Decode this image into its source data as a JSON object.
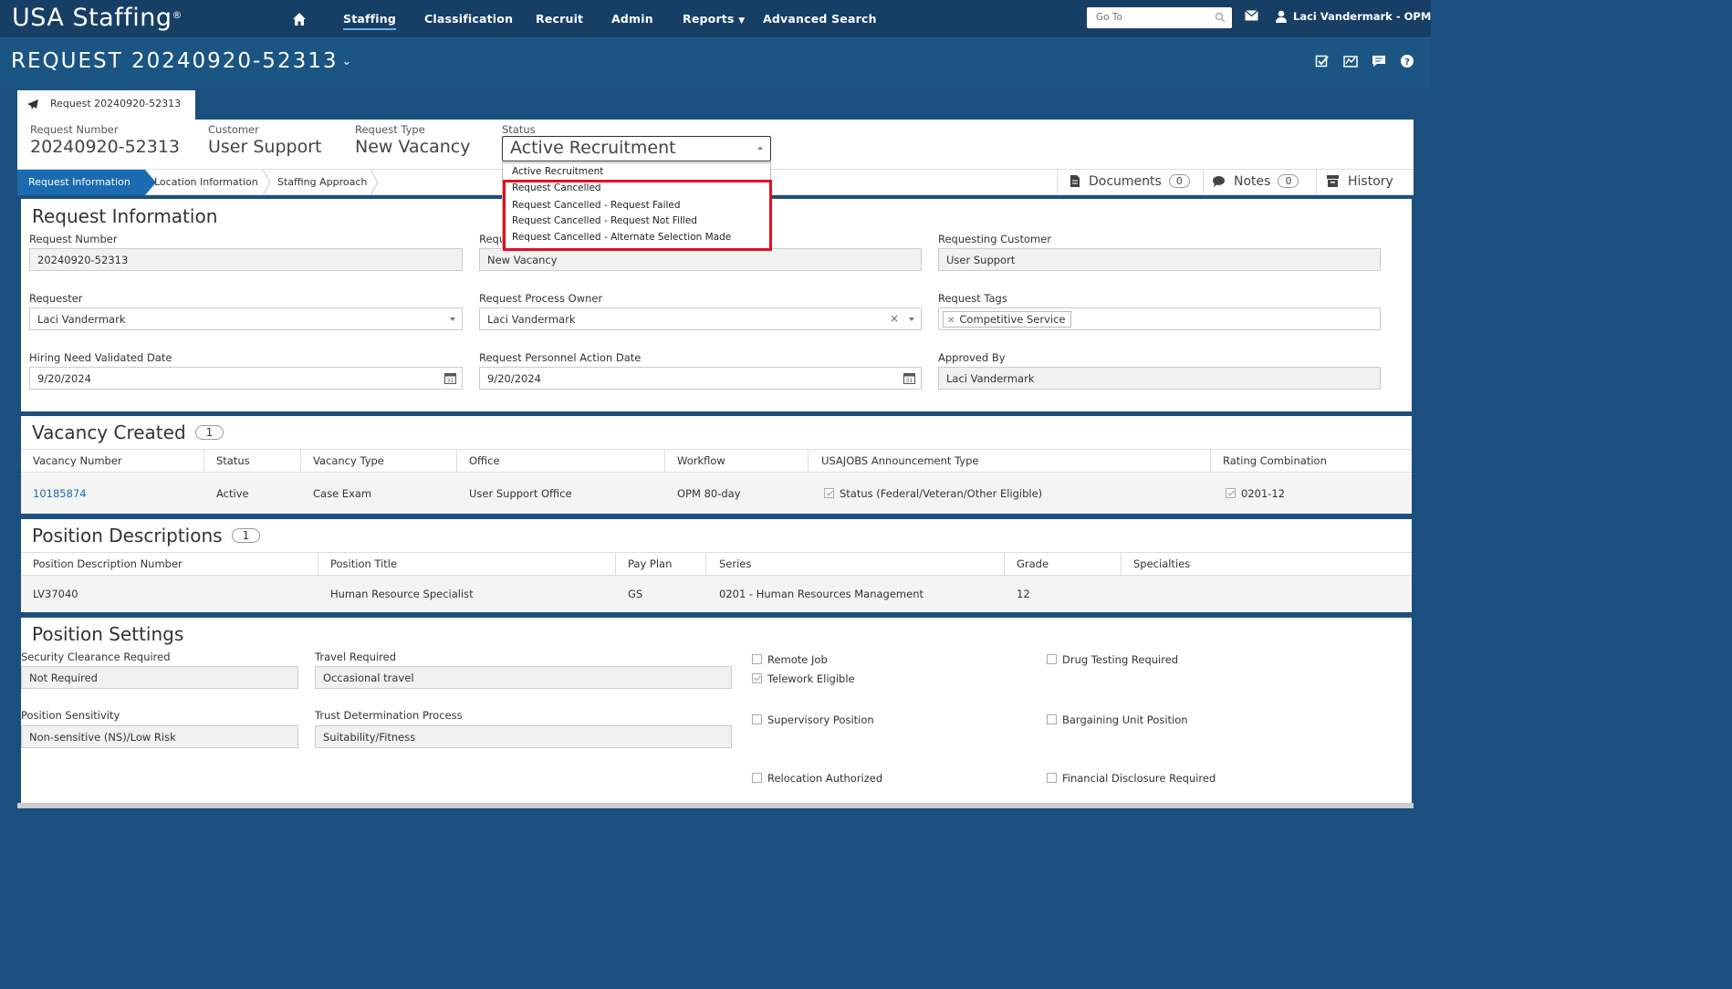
{
  "topbar": {
    "brand": "USA Staffing",
    "brand_mark": "®",
    "nav": [
      "Staffing",
      "Classification",
      "Recruit",
      "Admin",
      "Reports",
      "Advanced Search"
    ],
    "active_nav": "Staffing",
    "goto_placeholder": "Go To",
    "user": "Laci Vandermark - OPM"
  },
  "header": {
    "title": "REQUEST 20240920-52313",
    "tab_label": "Request 20240920-52313"
  },
  "summary": {
    "request_number_label": "Request Number",
    "request_number": "20240920-52313",
    "customer_label": "Customer",
    "customer": "User Support",
    "request_type_label": "Request Type",
    "request_type": "New Vacancy",
    "status_label": "Status",
    "status": "Active Recruitment"
  },
  "status_dropdown": {
    "options": [
      "Active Recruitment",
      "Request Cancelled",
      "Request Cancelled - Request Failed",
      "Request Cancelled - Request Not Filled",
      "Request Cancelled - Alternate Selection Made"
    ],
    "highlight_color": "#e0101e"
  },
  "subnav": {
    "crumbs": [
      "Request Information",
      "Location Information",
      "Staffing Approach"
    ],
    "documents_label": "Documents",
    "documents_count": "0",
    "notes_label": "Notes",
    "notes_count": "0",
    "history_label": "History"
  },
  "request_info": {
    "title": "Request Information",
    "request_number_label": "Request Number",
    "request_number": "20240920-52313",
    "request_type_label_partial": "Requ",
    "request_type": "New Vacancy",
    "requesting_customer_label": "Requesting Customer",
    "requesting_customer": "User Support",
    "requester_label": "Requester",
    "requester": "Laci Vandermark",
    "process_owner_label": "Request Process Owner",
    "process_owner": "Laci Vandermark",
    "tags_label": "Request Tags",
    "tag": "Competitive Service",
    "hiring_date_label": "Hiring Need Validated Date",
    "hiring_date": "9/20/2024",
    "pa_date_label": "Request Personnel Action Date",
    "pa_date": "9/20/2024",
    "approved_by_label": "Approved By",
    "approved_by": "Laci Vandermark"
  },
  "vacancy": {
    "title": "Vacancy Created",
    "count": "1",
    "headers": [
      "Vacancy Number",
      "Status",
      "Vacancy Type",
      "Office",
      "Workflow",
      "USAJOBS Announcement Type",
      "Rating Combination"
    ],
    "row": {
      "number": "10185874",
      "status": "Active",
      "type": "Case Exam",
      "office": "User Support Office",
      "workflow": "OPM 80-day",
      "announcement": "Status (Federal/Veteran/Other Eligible)",
      "rating": "0201-12"
    }
  },
  "positions": {
    "title": "Position Descriptions",
    "count": "1",
    "headers": [
      "Position Description Number",
      "Position Title",
      "Pay Plan",
      "Series",
      "Grade",
      "Specialties"
    ],
    "row": {
      "number": "LV37040",
      "title": "Human Resource Specialist",
      "pay_plan": "GS",
      "series": "0201 - Human Resources Management",
      "grade": "12",
      "specialties": ""
    }
  },
  "settings": {
    "title": "Position Settings",
    "clearance_label": "Security Clearance Required",
    "clearance": "Not Required",
    "travel_label": "Travel Required",
    "travel": "Occasional travel",
    "sensitivity_label": "Position Sensitivity",
    "sensitivity": "Non-sensitive (NS)/Low Risk",
    "trust_label": "Trust Determination Process",
    "trust": "Suitability/Fitness",
    "checkboxes": {
      "remote": {
        "label": "Remote Job",
        "checked": false
      },
      "telework": {
        "label": "Telework Eligible",
        "checked": true
      },
      "supervisory": {
        "label": "Supervisory Position",
        "checked": false
      },
      "relocation": {
        "label": "Relocation Authorized",
        "checked": false
      },
      "drug": {
        "label": "Drug Testing Required",
        "checked": false
      },
      "bargaining": {
        "label": "Bargaining Unit Position",
        "checked": false
      },
      "financial": {
        "label": "Financial Disclosure Required",
        "checked": false
      }
    }
  }
}
